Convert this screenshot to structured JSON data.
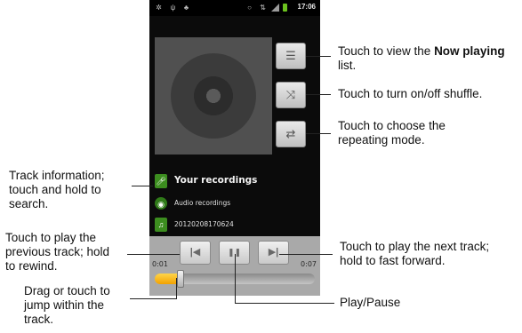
{
  "status_bar": {
    "time": "17:06"
  },
  "side_buttons": [
    {
      "name": "now-playing-list-button",
      "icon": "list-icon",
      "glyph": "☰"
    },
    {
      "name": "shuffle-button",
      "icon": "shuffle-icon",
      "glyph": "⤨"
    },
    {
      "name": "repeat-button",
      "icon": "repeat-icon",
      "glyph": "⇄"
    }
  ],
  "track": {
    "title": "Your recordings",
    "album": "Audio recordings",
    "file": "20120208170624"
  },
  "playback": {
    "elapsed": "0:01",
    "duration": "0:07",
    "progress": 0.16,
    "prev_glyph": "|◀",
    "play_pause_glyph": "❚❚",
    "next_glyph": "▶|"
  },
  "callouts": {
    "now_playing_pre": "Touch to view the ",
    "now_playing_bold": "Now playing",
    "now_playing_post": " list.",
    "shuffle": "Touch to turn on/off shuffle.",
    "repeat_line1": "Touch to choose the",
    "repeat_line2": "repeating mode.",
    "track_info_line1": "Track information;",
    "track_info_line2": "touch and hold to",
    "track_info_line3": "search.",
    "prev_line1": "Touch to play the",
    "prev_line2": "previous track; hold",
    "prev_line3": "to rewind.",
    "next_line1": "Touch to play the next track;",
    "next_line2": "hold to fast forward.",
    "drag_line1": "Drag or touch to",
    "drag_line2": "jump within the",
    "drag_line3": "track.",
    "play_pause": "Play/Pause"
  },
  "colors": {
    "accent_green": "#3c8d1f",
    "progress_fill": "#f2a200"
  }
}
